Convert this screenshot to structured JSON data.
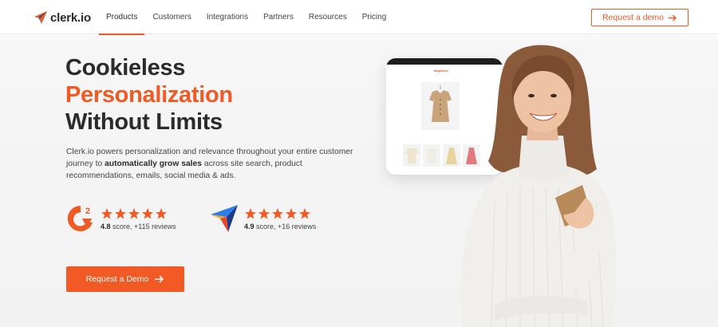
{
  "header": {
    "logo_text": "clerk.io",
    "nav": [
      {
        "label": "Products",
        "active": true
      },
      {
        "label": "Customers",
        "active": false
      },
      {
        "label": "Integrations",
        "active": false
      },
      {
        "label": "Partners",
        "active": false
      },
      {
        "label": "Resources",
        "active": false
      },
      {
        "label": "Pricing",
        "active": false
      }
    ],
    "cta_label": "Request a demo"
  },
  "hero": {
    "headline_line1": "Cookieless",
    "headline_line2": "Personalization",
    "headline_line3": "Without Limits",
    "sub_before": "Clerk.io powers personalization and relevance throughout your entire customer journey to ",
    "sub_bold": "automatically grow sales",
    "sub_after": " across site search, product recommendations, emails, social media & ads.",
    "ratings": [
      {
        "source_icon": "g2-logo-icon",
        "score": "4.8",
        "text": " score, +115 reviews",
        "stars": 5
      },
      {
        "source_icon": "capterra-logo-icon",
        "score": "4.9",
        "text": " score, +16 reviews",
        "stars": 5
      }
    ],
    "cta_label": "Request a Demo"
  },
  "device": {
    "brand": "MegaStore"
  },
  "colors": {
    "accent": "#f15a24",
    "text_dark": "#2b2b2b",
    "star": "#f15a24"
  }
}
